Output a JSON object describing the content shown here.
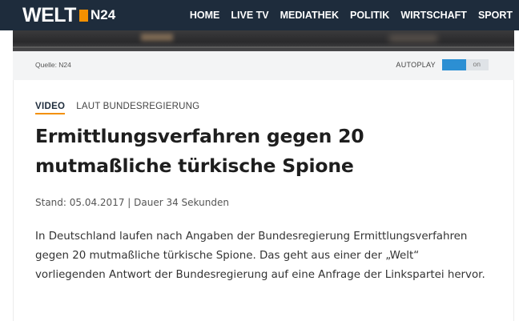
{
  "header": {
    "logo_welt": "WELT",
    "logo_n24": "N24",
    "nav": [
      "HOME",
      "LIVE TV",
      "MEDIATHEK",
      "POLITIK",
      "WIRTSCHAFT",
      "SPORT"
    ]
  },
  "video": {
    "source": "Quelle: N24",
    "autoplay_label": "AUTOPLAY",
    "autoplay_state": "on"
  },
  "article": {
    "type": "VIDEO",
    "topic": "LAUT BUNDESREGIERUNG",
    "headline": "Ermittlungsverfahren gegen 20 mutmaßliche türkische Spione",
    "meta": "Stand: 05.04.2017 | Dauer 34 Sekunden",
    "lead": "In Deutschland laufen nach Angaben der Bundesregierung Ermittlungsverfahren gegen 20 mutmaßliche türkische Spione. Das geht aus einer der „Welt“ vorliegenden Antwort der Bundesregierung auf eine Anfrage der Linkspartei hervor."
  },
  "colors": {
    "brand_navy": "#1e2c3c",
    "accent_orange": "#f39000",
    "toggle_blue": "#2c8fd3"
  }
}
